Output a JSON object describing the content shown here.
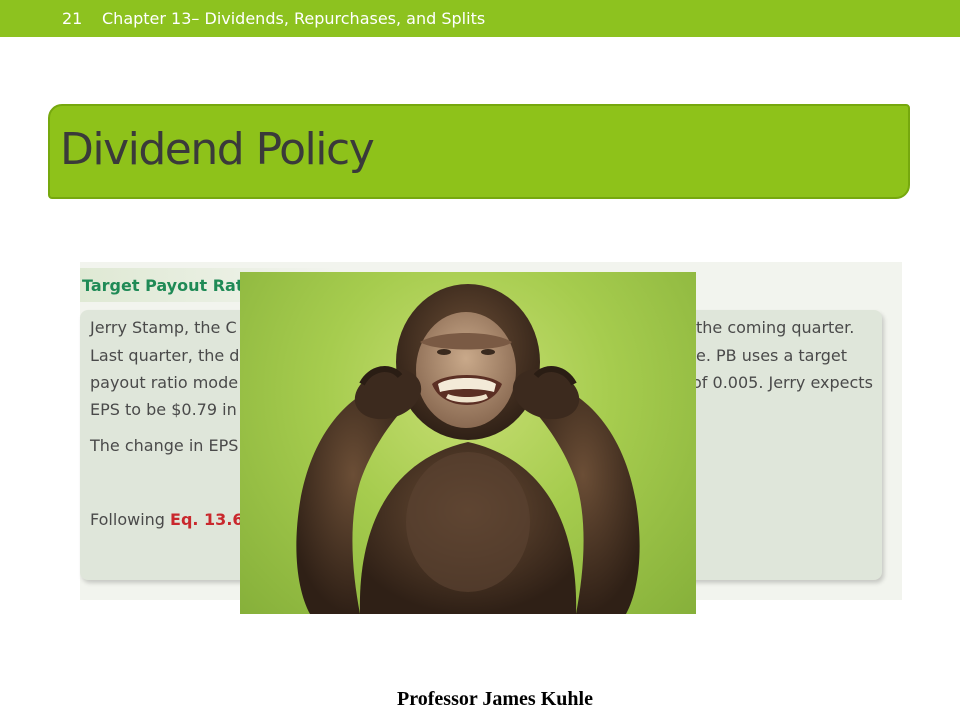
{
  "header": {
    "slide_number": "21",
    "chapter_title": "Chapter 13– Dividends, Repurchases, and Splits"
  },
  "slide": {
    "title": "Dividend Policy"
  },
  "example": {
    "heading": "Target Payout Rat",
    "lines": {
      "l1a": "Jerry Stamp, the C",
      "l1b": "the coming quarter.",
      "l2a": "Last quarter, the di",
      "l2b": "e. PB uses a target",
      "l3a": "payout ratio mode",
      "l3b": "of 0.005. Jerry expects",
      "l4a": "EPS to be $0.79 in",
      "l5a": "The change in EPS",
      "l6a": "Following ",
      "l6b": "Eq. 13.6"
    }
  },
  "photo": {
    "subject": "chimpanzee covering ears"
  },
  "footer": {
    "text": "Professor James Kuhle"
  },
  "colors": {
    "accent_green": "#8dc21f",
    "title_text": "#3a3a3a",
    "example_heading": "#1f8a56",
    "equation_red": "#c9282d"
  }
}
